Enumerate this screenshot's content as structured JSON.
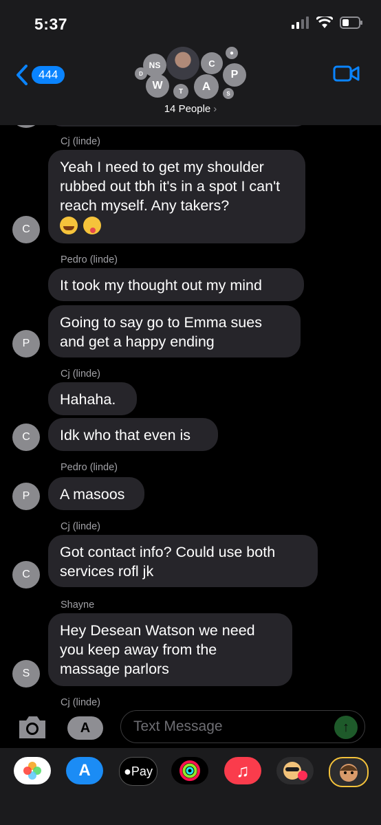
{
  "status_bar": {
    "time": "5:37"
  },
  "header": {
    "back_count": "444",
    "group_subtitle": "14 People",
    "avatar_initials": [
      "NS",
      "C",
      "D",
      "W",
      "T",
      "A",
      "P",
      "S"
    ]
  },
  "messages": [
    {
      "sender": "Cj  (linde)",
      "bubbles": [
        "Yeah I need to get my shoulder rubbed out tbh it's in a spot I can't reach myself. Any takers?"
      ],
      "avatar": "C"
    },
    {
      "sender": "Pedro (linde)",
      "bubbles": [
        "It took my thought out my mind",
        "Going to say go to Emma sues and get a happy ending"
      ],
      "avatar": "P"
    },
    {
      "sender": "Cj  (linde)",
      "bubbles": [
        "Hahaha.",
        "Idk who that even is"
      ],
      "avatar": "C"
    },
    {
      "sender": "Pedro (linde)",
      "bubbles": [
        "A masoos"
      ],
      "avatar": "P"
    },
    {
      "sender": "Cj  (linde)",
      "bubbles": [
        "Got contact info? Could use both services rofl jk"
      ],
      "avatar": "C"
    },
    {
      "sender": "Shayne",
      "bubbles": [
        "Hey Desean Watson we need you keep away from the massage parlors"
      ],
      "avatar": "S"
    },
    {
      "sender": "Cj  (linde)"
    }
  ],
  "input": {
    "placeholder": "Text Message"
  },
  "app_drawer": {
    "apple_pay_label": "Pay"
  },
  "colors": {
    "bubble": "#26252a",
    "accent": "#0a84ff",
    "send": "#1e5a2a"
  }
}
